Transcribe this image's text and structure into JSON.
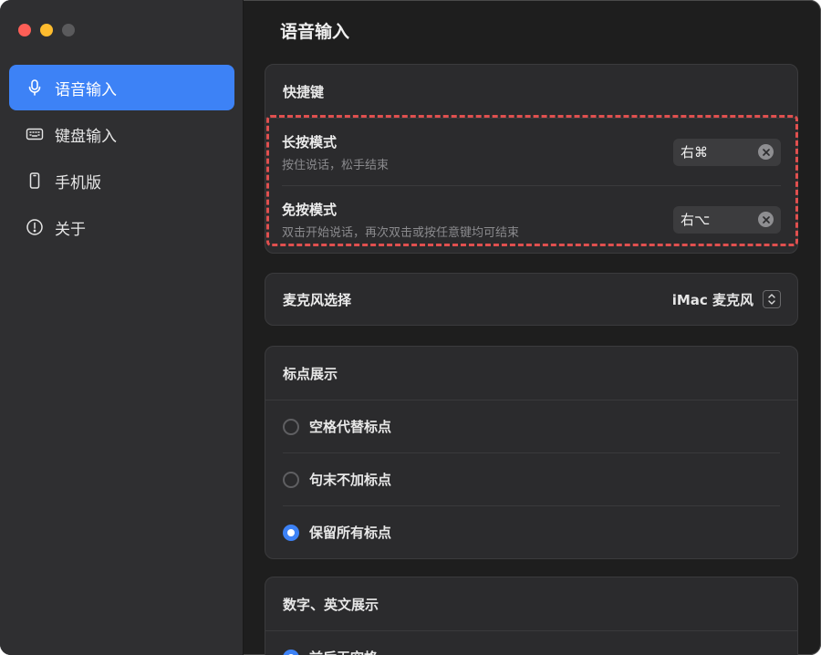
{
  "window": {
    "traffic_lights": [
      "close",
      "minimize",
      "zoom"
    ]
  },
  "sidebar": {
    "items": [
      {
        "label": "语音输入",
        "icon": "microphone-icon",
        "active": true
      },
      {
        "label": "键盘输入",
        "icon": "keyboard-icon",
        "active": false
      },
      {
        "label": "手机版",
        "icon": "phone-icon",
        "active": false
      },
      {
        "label": "关于",
        "icon": "info-icon",
        "active": false
      }
    ]
  },
  "main": {
    "title": "语音输入",
    "shortcuts": {
      "header": "快捷键",
      "rows": [
        {
          "title": "长按模式",
          "subtitle": "按住说话，松手结束",
          "key": "右⌘"
        },
        {
          "title": "免按模式",
          "subtitle": "双击开始说话，再次双击或按任意键均可结束",
          "key": "右⌥"
        }
      ]
    },
    "microphone": {
      "label": "麦克风选择",
      "value": "iMac 麦克风"
    },
    "punctuation": {
      "header": "标点展示",
      "options": [
        {
          "label": "空格代替标点",
          "checked": false
        },
        {
          "label": "句末不加标点",
          "checked": false
        },
        {
          "label": "保留所有标点",
          "checked": true
        }
      ]
    },
    "numbers": {
      "header": "数字、英文展示",
      "options": [
        {
          "label": "前后无空格",
          "checked": true
        }
      ]
    }
  },
  "colors": {
    "accent": "#3d82f6",
    "highlight": "#e0504f"
  }
}
